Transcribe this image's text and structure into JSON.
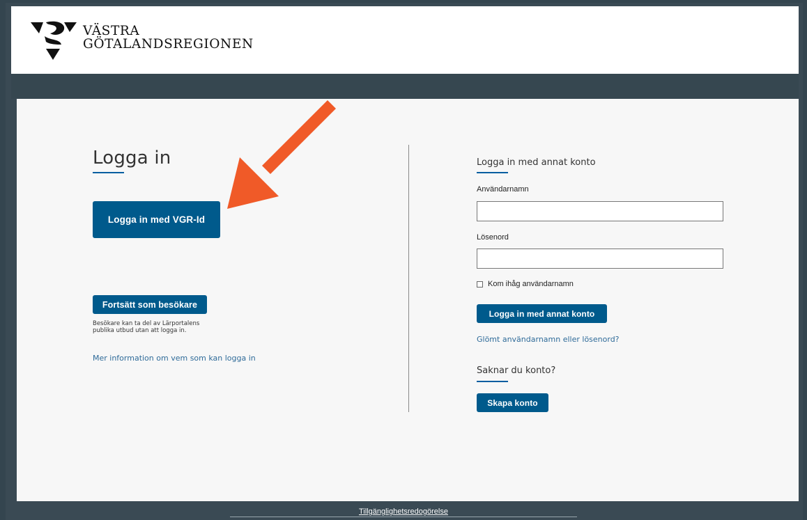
{
  "brand": {
    "line1": "VÄSTRA",
    "line2": "GÖTALANDSREGIONEN",
    "logo_icon": "vgr-logo-icon"
  },
  "login": {
    "title": "Logga in",
    "vgr_button": "Logga in med VGR-Id",
    "visitor_button": "Fortsätt som besökare",
    "visitor_note_line1": "Besökare kan ta del av Lärportalens",
    "visitor_note_line2": "publika utbud utan att logga in.",
    "more_info_link": "Mer information om vem som kan logga in"
  },
  "other_account": {
    "title": "Logga in med annat konto",
    "username_label": "Användarnamn",
    "username_value": "",
    "password_label": "Lösenord",
    "password_value": "",
    "remember_label": "Kom ihåg användarnamn",
    "remember_checked": false,
    "submit_button": "Logga in med annat konto",
    "forgot_link": "Glömt användarnamn eller lösenord?"
  },
  "signup": {
    "title": "Saknar du konto?",
    "create_button": "Skapa konto"
  },
  "footer": {
    "accessibility_link": "Tillgänglighetsredogörelse"
  },
  "colors": {
    "primary_button": "#005a8c",
    "link": "#2f6b99",
    "arrow": "#f05a28",
    "dark_band": "#364750"
  },
  "annotation": {
    "arrow_icon": "arrow-pointer-icon"
  }
}
